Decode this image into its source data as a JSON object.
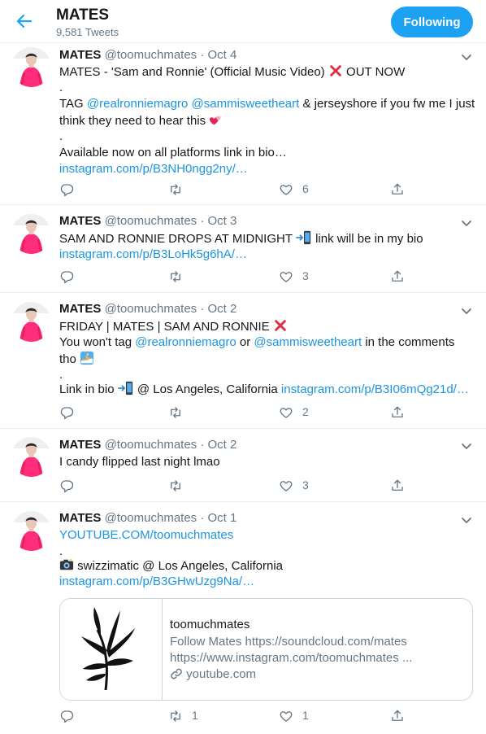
{
  "header": {
    "title": "MATES",
    "tweet_count": "9,581 Tweets",
    "follow_label": "Following"
  },
  "tweets": [
    {
      "name": "MATES",
      "handle": "@toomuchmates",
      "sep": "·",
      "date": "Oct 4",
      "l1": "MATES - 'Sam and Ronnie' (Official Music Video)",
      "l1b": "OUT NOW",
      "dot": ".",
      "tag": "TAG",
      "m1": "@realronniemagro",
      "m2": "@sammisweetheart",
      "l2rest": "& jerseyshore if you fw me I just",
      "l3": "think they need to hear this",
      "avail": "Available now on all platforms link in bio…",
      "url": "instagram.com/p/B3NH0ngg2ny/…",
      "likes": "6"
    },
    {
      "name": "MATES",
      "handle": "@toomuchmates",
      "sep": "·",
      "date": "Oct 3",
      "l1": "SAM AND RONNIE DROPS AT MIDNIGHT",
      "l1b": "link will be in my bio",
      "url": "instagram.com/p/B3LoHk5g6hA/…",
      "likes": "3"
    },
    {
      "name": "MATES",
      "handle": "@toomuchmates",
      "sep": "·",
      "date": "Oct 2",
      "l1": "FRIDAY | MATES | SAM AND RONNIE",
      "l2a": "You won't tag",
      "m1": "@realronniemagro",
      "l2or": "or",
      "m2": "@sammisweetheart",
      "l2b": "in the comments",
      "l3": "tho",
      "dot": ".",
      "l4a": "Link in bio",
      "l4b": "@ Los Angeles, California",
      "url": "instagram.com/p/B3I06mQg21d/…",
      "likes": "2"
    },
    {
      "name": "MATES",
      "handle": "@toomuchmates",
      "sep": "·",
      "date": "Oct 2",
      "l1": "I candy flipped last night lmao",
      "likes": "3"
    },
    {
      "name": "MATES",
      "handle": "@toomuchmates",
      "sep": "·",
      "date": "Oct 1",
      "yt": "YOUTUBE.COM/toomuchmates",
      "dot": ".",
      "l2": "swizzimatic @ Los Angeles, California",
      "url": "instagram.com/p/B3GHwUzg9Na/…",
      "card": {
        "title": "toomuchmates",
        "desc1": "Follow Mates https://soundcloud.com/mates",
        "desc2": "https://www.instagram.com/toomuchmates ...",
        "domain": "youtube.com"
      },
      "retweets": "1",
      "likes": "1"
    }
  ],
  "colors": {
    "accent": "#1da1f2",
    "link": "#1b95e0",
    "muted": "#657786",
    "avatar_shirt": "#ff2d7a"
  }
}
